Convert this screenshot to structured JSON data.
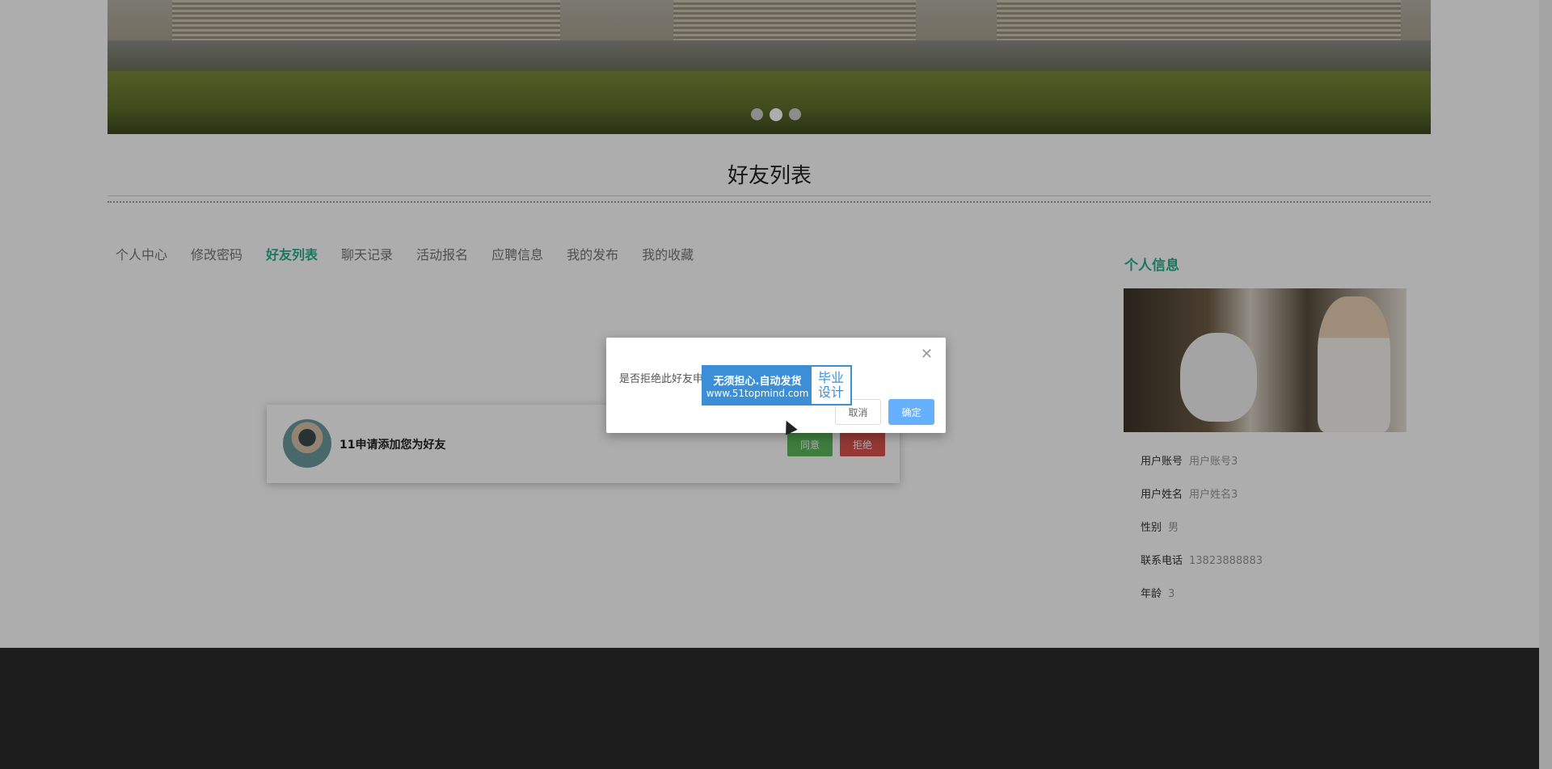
{
  "banner": {
    "slides": 3,
    "active_slide": 2
  },
  "page": {
    "title": "好友列表"
  },
  "tabs": [
    {
      "label": "个人中心"
    },
    {
      "label": "修改密码"
    },
    {
      "label": "好友列表",
      "active": true
    },
    {
      "label": "聊天记录"
    },
    {
      "label": "活动报名"
    },
    {
      "label": "应聘信息"
    },
    {
      "label": "我的发布"
    },
    {
      "label": "我的收藏"
    }
  ],
  "friend_request": {
    "text": "11申请添加您为好友",
    "agree_label": "同意",
    "reject_label": "拒绝"
  },
  "sidebar": {
    "title": "个人信息",
    "rows": [
      {
        "label": "用户账号",
        "value": "用户账号3"
      },
      {
        "label": "用户姓名",
        "value": "用户姓名3"
      },
      {
        "label": "性别",
        "value": "男"
      },
      {
        "label": "联系电话",
        "value": "13823888883"
      },
      {
        "label": "年龄",
        "value": "3"
      }
    ]
  },
  "dialog": {
    "message": "是否拒绝此好友申请",
    "cancel_label": "取消",
    "ok_label": "确定",
    "close_icon": "close-icon"
  },
  "watermark": {
    "line1": "无须担心.自动发货",
    "line2": "www.51topmind.com",
    "right1": "毕业",
    "right2": "设计"
  },
  "colors": {
    "accent": "#2ab08a",
    "agree": "#5cb85c",
    "reject": "#d9534f",
    "ok": "#66b1ff",
    "footer": "#2b2b2b"
  }
}
